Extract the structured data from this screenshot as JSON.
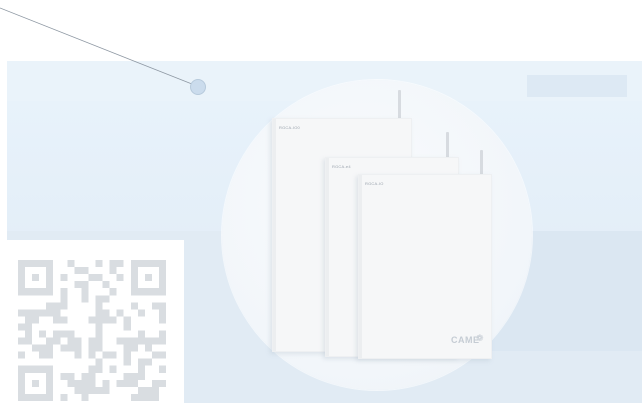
{
  "product_image": {
    "devices": [
      {
        "label": "RGCA-IO0"
      },
      {
        "label": "RGCA-e4"
      },
      {
        "label": "RGCA-IO"
      }
    ],
    "brand": "CAME",
    "brand_mark": "❁"
  },
  "hotspot": {
    "icon": "pin-dot-icon"
  },
  "qr_code": {
    "icon": "qr-code-icon"
  },
  "colors": {
    "scene_bg": "#e6f0f9",
    "circle_bg": "#f4f7fa",
    "device": "#f6f7f8",
    "line": "#8e98a3"
  }
}
